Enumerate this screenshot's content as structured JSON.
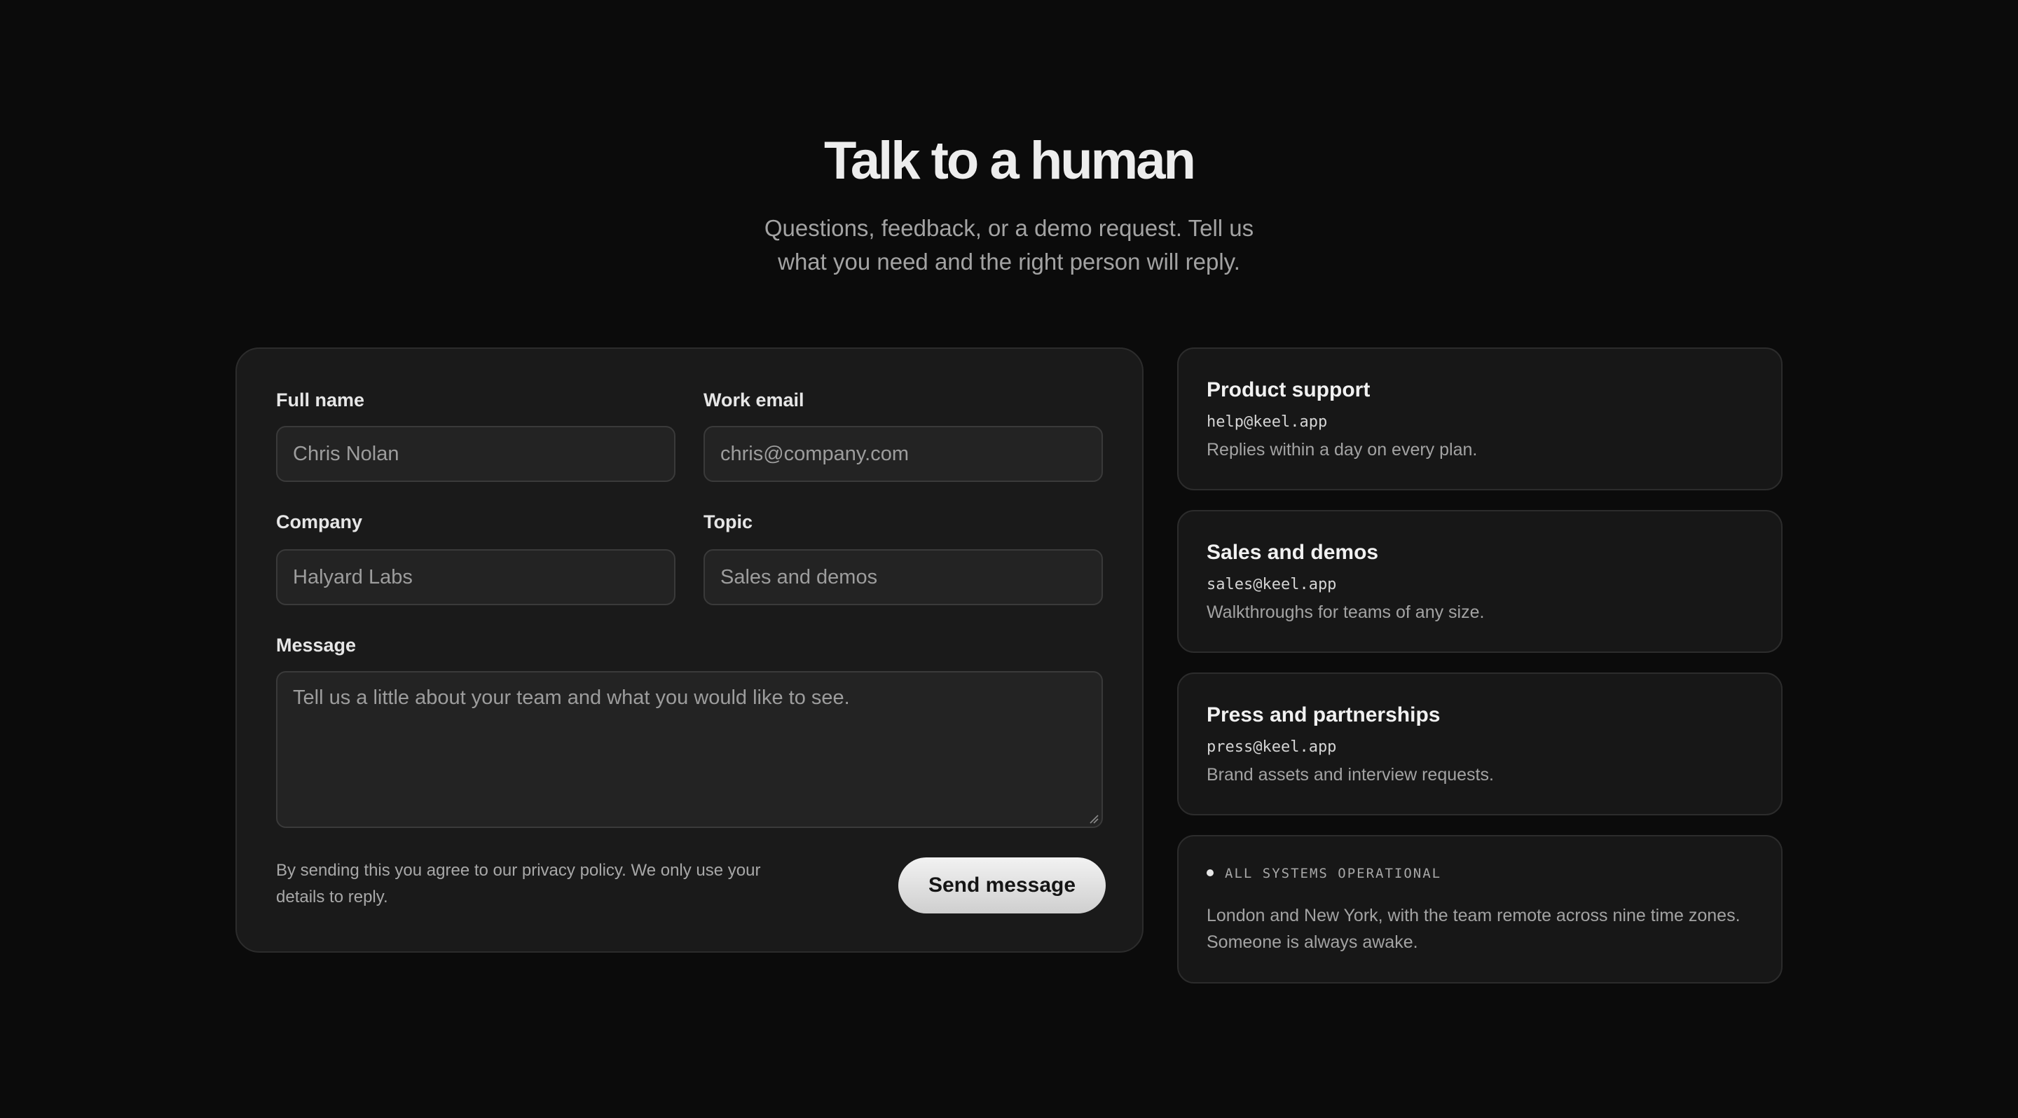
{
  "hero": {
    "title": "Talk to a human",
    "subtitle": "Questions, feedback, or a demo request. Tell us what you need and the right person will reply."
  },
  "form": {
    "full_name": {
      "label": "Full name",
      "value": "Chris Nolan"
    },
    "work_email": {
      "label": "Work email",
      "value": "chris@company.com"
    },
    "company": {
      "label": "Company",
      "value": "Halyard Labs"
    },
    "topic": {
      "label": "Topic",
      "value": "Sales and demos"
    },
    "message": {
      "label": "Message",
      "placeholder": "Tell us a little about your team and what you would like to see."
    },
    "legal": "By sending this you agree to our privacy policy. We only use your details to reply.",
    "send_label": "Send message"
  },
  "contacts": [
    {
      "title": "Product support",
      "email": "help@keel.app",
      "desc": "Replies within a day on every plan."
    },
    {
      "title": "Sales and demos",
      "email": "sales@keel.app",
      "desc": "Walkthroughs for teams of any size."
    },
    {
      "title": "Press and partnerships",
      "email": "press@keel.app",
      "desc": "Brand assets and interview requests."
    }
  ],
  "status": {
    "label": "ALL SYSTEMS OPERATIONAL",
    "text": "London and New York, with the team remote across nine time zones. Someone is always awake."
  },
  "colors": {
    "background": "#0b0b0b",
    "card": "#1a1a1a",
    "button": "#e6e6e6"
  }
}
